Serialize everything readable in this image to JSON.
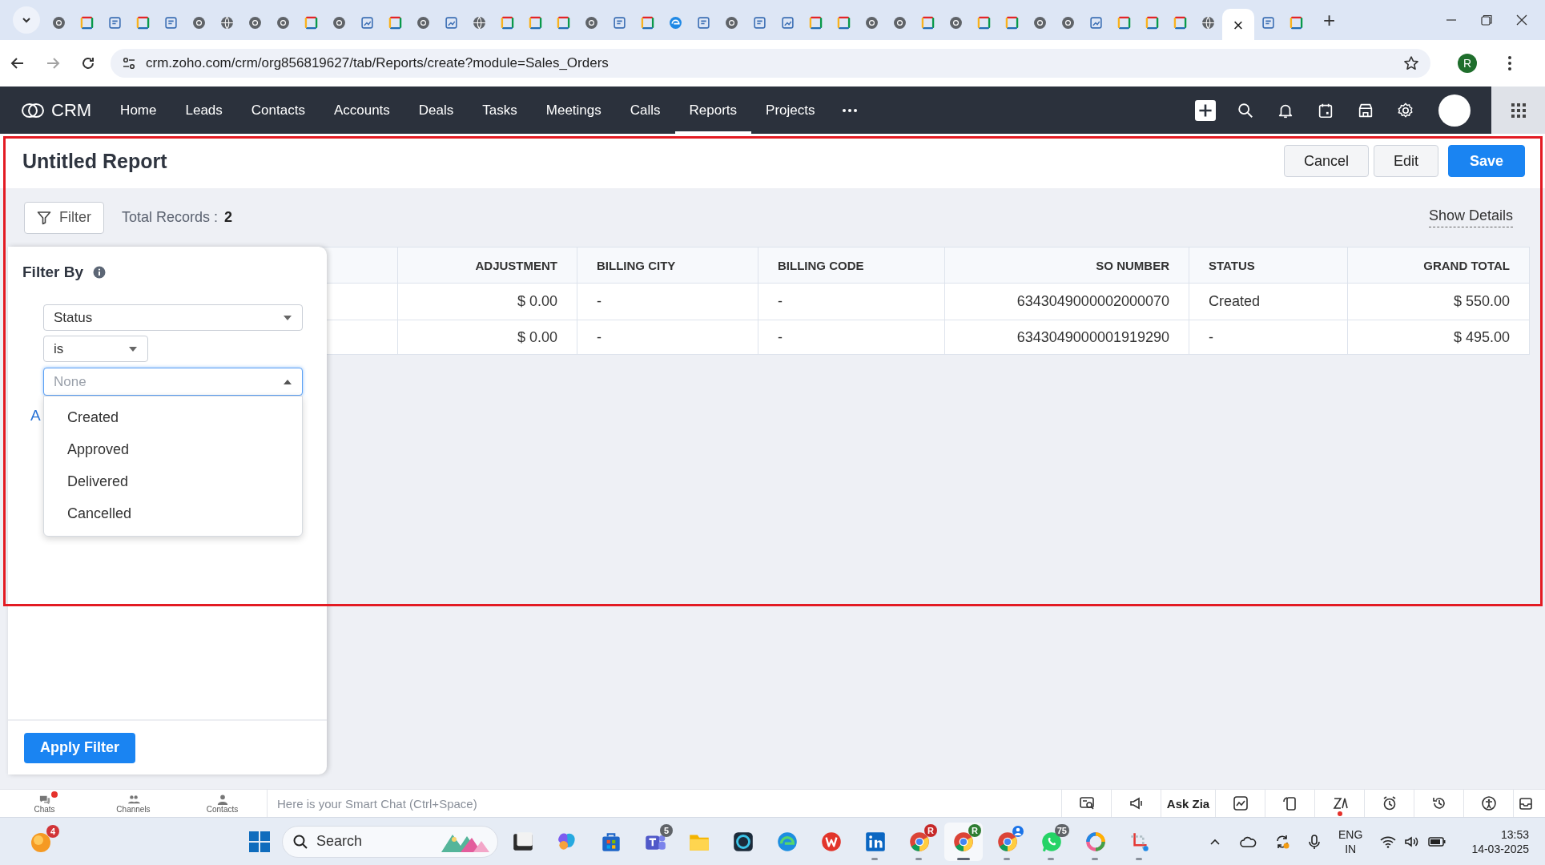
{
  "browser": {
    "tabs": [
      {
        "kind": "chrome",
        "selected": false
      },
      {
        "kind": "zoho",
        "selected": false
      },
      {
        "kind": "doc",
        "selected": false
      },
      {
        "kind": "zoho",
        "selected": false
      },
      {
        "kind": "doc",
        "selected": false
      },
      {
        "kind": "chrome",
        "selected": false
      },
      {
        "kind": "globe",
        "selected": false
      },
      {
        "kind": "chrome",
        "selected": false
      },
      {
        "kind": "chrome",
        "selected": false
      },
      {
        "kind": "zoho",
        "selected": false
      },
      {
        "kind": "chrome",
        "selected": false
      },
      {
        "kind": "chart",
        "selected": false
      },
      {
        "kind": "zoho",
        "selected": false
      },
      {
        "kind": "chrome",
        "selected": false
      },
      {
        "kind": "chart",
        "selected": false
      },
      {
        "kind": "globe",
        "selected": false
      },
      {
        "kind": "zoho",
        "selected": false
      },
      {
        "kind": "zoho",
        "selected": false
      },
      {
        "kind": "zoho",
        "selected": false
      },
      {
        "kind": "chrome",
        "selected": false
      },
      {
        "kind": "doc",
        "selected": false
      },
      {
        "kind": "zoho",
        "selected": false
      },
      {
        "kind": "edge",
        "selected": false
      },
      {
        "kind": "doc",
        "selected": false
      },
      {
        "kind": "chrome",
        "selected": false
      },
      {
        "kind": "doc",
        "selected": false
      },
      {
        "kind": "chart",
        "selected": false
      },
      {
        "kind": "zoho",
        "selected": false
      },
      {
        "kind": "zoho",
        "selected": false
      },
      {
        "kind": "chrome",
        "selected": false
      },
      {
        "kind": "chrome",
        "selected": false
      },
      {
        "kind": "zoho",
        "selected": false
      },
      {
        "kind": "chrome",
        "selected": false
      },
      {
        "kind": "zoho",
        "selected": false
      },
      {
        "kind": "zoho",
        "selected": false
      },
      {
        "kind": "chrome",
        "selected": false
      },
      {
        "kind": "chrome",
        "selected": false
      },
      {
        "kind": "chart",
        "selected": false
      },
      {
        "kind": "zoho",
        "selected": false
      },
      {
        "kind": "zoho",
        "selected": false
      },
      {
        "kind": "zoho",
        "selected": false
      },
      {
        "kind": "globe",
        "selected": false
      },
      {
        "kind": "blank",
        "selected": true
      },
      {
        "kind": "doc",
        "selected": false
      },
      {
        "kind": "zoho",
        "selected": false
      }
    ],
    "close_label": "×",
    "new_tab": "+",
    "url": "crm.zoho.com/crm/org856819627/tab/Reports/create?module=Sales_Orders",
    "profile_initial": "R"
  },
  "nav": {
    "product": "CRM",
    "items": [
      {
        "label": "Home",
        "selected": false
      },
      {
        "label": "Leads",
        "selected": false
      },
      {
        "label": "Contacts",
        "selected": false
      },
      {
        "label": "Accounts",
        "selected": false
      },
      {
        "label": "Deals",
        "selected": false
      },
      {
        "label": "Tasks",
        "selected": false
      },
      {
        "label": "Meetings",
        "selected": false
      },
      {
        "label": "Calls",
        "selected": false
      },
      {
        "label": "Reports",
        "selected": true
      },
      {
        "label": "Projects",
        "selected": false
      }
    ]
  },
  "report": {
    "title": "Untitled Report",
    "buttons": [
      {
        "label": "Cancel",
        "kind": "secondary"
      },
      {
        "label": "Edit",
        "kind": "secondary"
      },
      {
        "label": "Save",
        "kind": "primary"
      }
    ],
    "filter_button": "Filter",
    "total_records_label": "Total Records :",
    "total_records": "2",
    "show_details": "Show Details",
    "table": {
      "columns": [
        "ADJUSTMENT",
        "BILLING CITY",
        "BILLING CODE",
        "SO NUMBER",
        "STATUS",
        "GRAND TOTAL"
      ],
      "rows": [
        [
          "$ 0.00",
          "-",
          "-",
          "6343049000002000070",
          "Created",
          "$ 550.00"
        ],
        [
          "$ 0.00",
          "-",
          "-",
          "6343049000001919290",
          "-",
          "$ 495.00"
        ]
      ]
    }
  },
  "filter_panel": {
    "title": "Filter By",
    "field": "Status",
    "operator": "is",
    "value_placeholder": "None",
    "expanded": true,
    "options": [
      "Created",
      "Approved",
      "Delivered",
      "Cancelled"
    ],
    "link_partial": "A",
    "apply_button": "Apply Filter"
  },
  "annotation": {
    "kind": "highlight-frame"
  },
  "chat_bar": {
    "tabs": [
      "Chats",
      "Channels",
      "Contacts"
    ],
    "chats_unread": true,
    "placeholder": "Here is your Smart Chat (Ctrl+Space)",
    "ask_label": "Ask Zia"
  },
  "taskbar": {
    "weather_badge": "4",
    "search_placeholder": "Search",
    "apps": [
      {
        "kind": "terminal",
        "running": false,
        "selected": false
      },
      {
        "kind": "copilot",
        "running": false,
        "selected": false
      },
      {
        "kind": "store",
        "running": false,
        "selected": false
      },
      {
        "kind": "teams",
        "running": false,
        "selected": false,
        "badge": "5",
        "color": "#5f6368"
      },
      {
        "kind": "folder",
        "running": false,
        "selected": false
      },
      {
        "kind": "ring",
        "running": false,
        "selected": false
      },
      {
        "kind": "edge",
        "running": false,
        "selected": false
      },
      {
        "kind": "office",
        "running": false,
        "selected": false
      },
      {
        "kind": "linkedin",
        "running": true,
        "selected": false
      },
      {
        "kind": "chrome",
        "running": true,
        "selected": false,
        "badge": "R",
        "color": "#c62828"
      },
      {
        "kind": "chrome",
        "running": true,
        "selected": true,
        "badge": "R",
        "color": "#2e7d32"
      },
      {
        "kind": "chrome-profile",
        "running": true,
        "selected": false
      },
      {
        "kind": "whatsapp",
        "running": true,
        "selected": false,
        "badge": "75",
        "color": "#5f6368"
      },
      {
        "kind": "photos",
        "running": true,
        "selected": false
      },
      {
        "kind": "snip",
        "running": true,
        "selected": false
      }
    ],
    "language": "ENG",
    "region": "IN",
    "time": "13:53",
    "date": "14-03-2025"
  }
}
